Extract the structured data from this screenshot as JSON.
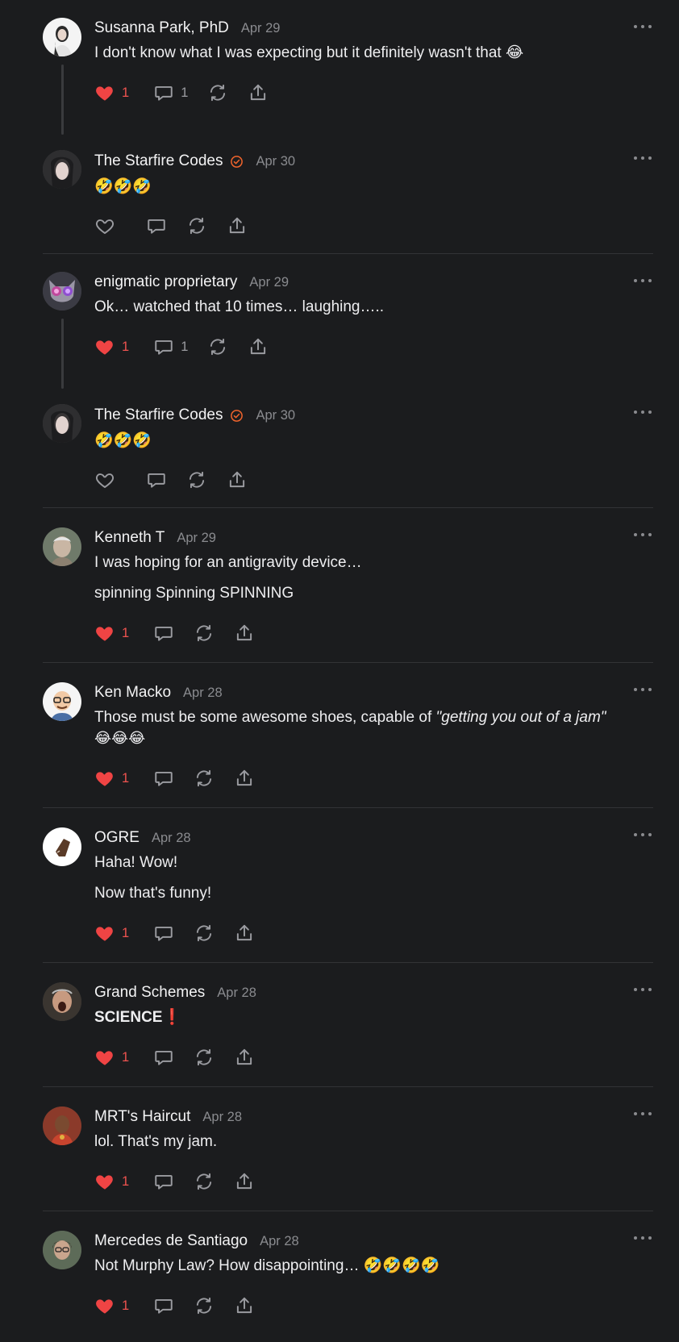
{
  "colors": {
    "background": "#1b1c1e",
    "liked": "#ef4444",
    "verified": "#f0642c",
    "muted": "#8a8b8f"
  },
  "icons": {
    "like": "heart-icon",
    "reply": "comment-bubble-icon",
    "restack": "restack-icon",
    "share": "share-upload-icon",
    "more": "ellipsis-icon",
    "verified": "verified-badge-icon"
  },
  "comments": [
    {
      "author": "Susanna Park, PhD",
      "date": "Apr 29",
      "text": "I don't know what I was expecting but it definitely wasn't that 😂",
      "likes": "1",
      "replies": "1"
    },
    {
      "author": "The Starfire Codes",
      "date": "Apr 30",
      "text": "🤣🤣🤣"
    },
    {
      "author": "enigmatic proprietary",
      "date": "Apr 29",
      "text": "Ok… watched that 10 times… laughing…..",
      "likes": "1",
      "replies": "1"
    },
    {
      "author": "The Starfire Codes",
      "date": "Apr 30",
      "text": "🤣🤣🤣"
    },
    {
      "author": "Kenneth T",
      "date": "Apr 29",
      "text": "I was hoping for an antigravity device…",
      "text2": "spinning Spinning SPINNING",
      "likes": "1"
    },
    {
      "author": "Ken Macko",
      "date": "Apr 28",
      "text_a": "Those must be some awesome shoes, capable of ",
      "text_em": "\"getting you out of a jam\"",
      "text_b": "😂😂😂",
      "likes": "1"
    },
    {
      "author": "OGRE",
      "date": "Apr 28",
      "text": "Haha! Wow!",
      "text2": "Now that's funny!",
      "likes": "1"
    },
    {
      "author": "Grand Schemes",
      "date": "Apr 28",
      "text": "SCIENCE❗",
      "likes": "1"
    },
    {
      "author": "MRT's Haircut",
      "date": "Apr 28",
      "text": "lol. That's my jam.",
      "likes": "1"
    },
    {
      "author": "Mercedes de Santiago",
      "date": "Apr 28",
      "text": "Not Murphy Law? How disappointing… 🤣🤣🤣🤣",
      "likes": "1"
    }
  ]
}
